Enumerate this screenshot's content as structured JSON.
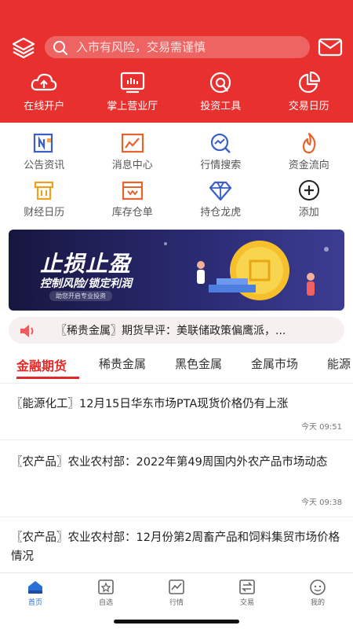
{
  "search": {
    "placeholder": "入市有风险，交易需谨慎"
  },
  "quick_actions": [
    {
      "label": "在线开户",
      "icon": "cloud-icon"
    },
    {
      "label": "掌上营业厅",
      "icon": "monitor-icon"
    },
    {
      "label": "投资工具",
      "icon": "tool-icon"
    },
    {
      "label": "交易日历",
      "icon": "pie-chart-icon"
    }
  ],
  "grid": [
    {
      "label": "公告资讯",
      "icon": "news-icon"
    },
    {
      "label": "消息中心",
      "icon": "chart-message-icon"
    },
    {
      "label": "行情搜索",
      "icon": "search-trend-icon"
    },
    {
      "label": "资金流向",
      "icon": "flame-icon"
    },
    {
      "label": "财经日历",
      "icon": "calendar-icon"
    },
    {
      "label": "库存仓单",
      "icon": "warehouse-icon"
    },
    {
      "label": "持仓龙虎",
      "icon": "diamond-icon"
    },
    {
      "label": "添加",
      "icon": "add-icon"
    }
  ],
  "banner": {
    "title": "止损止盈",
    "subtitle": "控制风险/锁定利润",
    "tag": "助您开启专业投资"
  },
  "notice": {
    "text": "〖稀贵金属〗期货早评：美联储政策偏鹰派，..."
  },
  "tabs": [
    "金融期货",
    "稀贵金属",
    "黑色金属",
    "金属市场",
    "能源"
  ],
  "news": [
    {
      "title": "〖能源化工〗12月15日华东市场PTA现货价格仍有上涨",
      "time": "今天 09:51"
    },
    {
      "title": "〖农产品〗农业农村部：2022年第49周国内外农产品市场动态",
      "time": "今天 09:38"
    },
    {
      "title": "〖农产品〗农业农村部：12月份第2周畜产品和饲料集贸市场价格情况",
      "time": ""
    }
  ],
  "tabbar": [
    {
      "label": "首页",
      "icon": "home-icon"
    },
    {
      "label": "自选",
      "icon": "star-icon"
    },
    {
      "label": "行情",
      "icon": "market-chart-icon"
    },
    {
      "label": "交易",
      "icon": "trade-icon"
    },
    {
      "label": "我的",
      "icon": "profile-icon"
    }
  ],
  "colors": {
    "brand": "#e8312f",
    "tab_active": "#e02a28",
    "bottom_active": "#2b6fd6"
  }
}
